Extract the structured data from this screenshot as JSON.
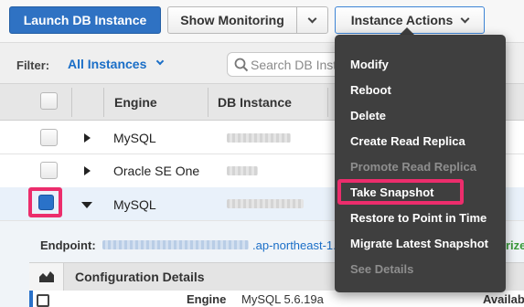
{
  "toolbar": {
    "launch_label": "Launch DB Instance",
    "monitoring_label": "Show Monitoring",
    "actions_label": "Instance Actions"
  },
  "filter": {
    "label": "Filter:",
    "value": "All Instances",
    "search_placeholder": "Search DB Inst"
  },
  "table": {
    "headers": [
      "Engine",
      "DB Instance"
    ],
    "rows": [
      {
        "engine": "MySQL",
        "expanded": false,
        "selected": false
      },
      {
        "engine": "Oracle SE One",
        "expanded": false,
        "selected": false
      },
      {
        "engine": "MySQL",
        "expanded": true,
        "selected": true
      }
    ]
  },
  "details": {
    "endpoint_label": "Endpoint:",
    "endpoint_suffix": ".ap-northeast-1.r",
    "config_title": "Configuration Details",
    "engine_key": "Engine",
    "engine_value": "MySQL 5.6.19a",
    "right_fragment": "Availab",
    "green_fragment": "rize"
  },
  "menu": {
    "items": [
      {
        "label": "Modify",
        "enabled": true
      },
      {
        "label": "Reboot",
        "enabled": true
      },
      {
        "label": "Delete",
        "enabled": true
      },
      {
        "label": "Create Read Replica",
        "enabled": true
      },
      {
        "label": "Promote Read Replica",
        "enabled": false
      },
      {
        "label": "Take Snapshot",
        "enabled": true
      },
      {
        "label": "Restore to Point in Time",
        "enabled": true
      },
      {
        "label": "Migrate Latest Snapshot",
        "enabled": true
      },
      {
        "label": "See Details",
        "enabled": false
      }
    ]
  },
  "colors": {
    "primary": "#2f72c3",
    "highlight": "#ec2d6c",
    "menu_bg": "#3f3f3f",
    "link": "#1a6ec7"
  }
}
